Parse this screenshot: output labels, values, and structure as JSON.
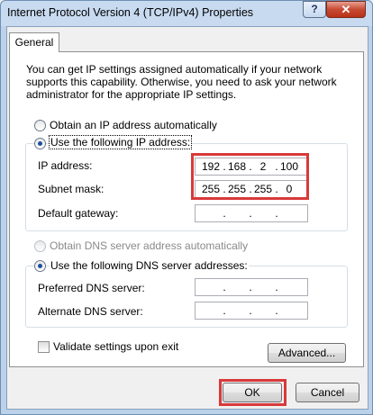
{
  "window": {
    "title": "Internet Protocol Version 4 (TCP/IPv4) Properties",
    "help_glyph": "?",
    "close_glyph": "✕"
  },
  "tab": {
    "label": "General"
  },
  "info_text": "You can get IP settings assigned automatically if your network supports this capability. Otherwise, you need to ask your network administrator for the appropriate IP settings.",
  "ip": {
    "auto_label": "Obtain an IP address automatically",
    "manual_label": "Use the following IP address:",
    "ip_label": "IP address:",
    "subnet_label": "Subnet mask:",
    "gateway_label": "Default gateway:",
    "ip_octets": [
      "192",
      "168",
      "2",
      "100"
    ],
    "subnet_octets": [
      "255",
      "255",
      "255",
      "0"
    ],
    "gateway_octets": [
      "",
      "",
      "",
      ""
    ]
  },
  "dns": {
    "auto_label": "Obtain DNS server address automatically",
    "manual_label": "Use the following DNS server addresses:",
    "preferred_label": "Preferred DNS server:",
    "alternate_label": "Alternate DNS server:"
  },
  "validate_label": "Validate settings upon exit",
  "advanced_label": "Advanced...",
  "ok_label": "OK",
  "cancel_label": "Cancel",
  "colors": {
    "highlight": "#d9393a",
    "accent": "#1d4f9c"
  }
}
